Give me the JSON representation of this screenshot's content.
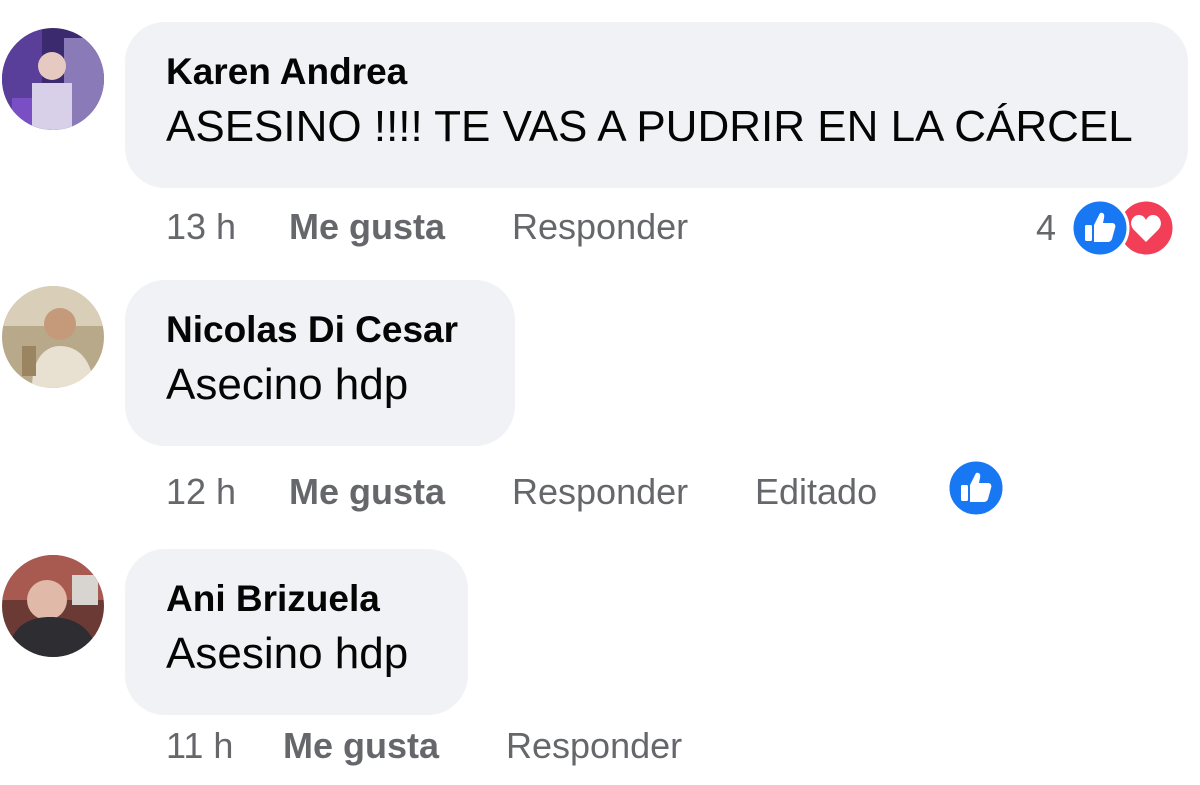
{
  "comments": [
    {
      "author": "Karen Andrea",
      "text": "ASESINO !!!! TE VAS A PUDRIR EN LA CÁRCEL",
      "time": "13 h",
      "like_label": "Me gusta",
      "reply_label": "Responder",
      "reaction_count": "4",
      "reactions": [
        "like-icon",
        "love-icon"
      ]
    },
    {
      "author": "Nicolas Di Cesar",
      "text": "Asecino hdp",
      "time": "12 h",
      "like_label": "Me gusta",
      "reply_label": "Responder",
      "edited_label": "Editado",
      "reactions": [
        "like-icon"
      ]
    },
    {
      "author": "Ani Brizuela",
      "text": "Asesino hdp",
      "time": "11 h",
      "like_label": "Me gusta",
      "reply_label": "Responder"
    }
  ],
  "colors": {
    "bubble": "#f0f2f5",
    "text": "#050505",
    "meta": "#65676b",
    "like_blue": "#1877f2",
    "love_red": "#f33e58"
  }
}
